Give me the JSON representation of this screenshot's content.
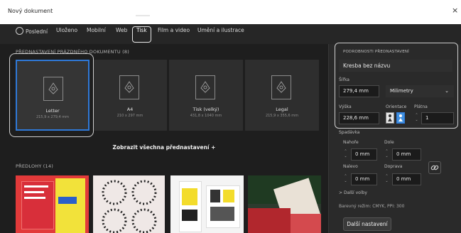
{
  "window": {
    "title": "Nový dokument",
    "close_glyph": "×"
  },
  "tabs": [
    {
      "label": "Poslední",
      "icon": "clock-icon"
    },
    {
      "label": "Uloženo"
    },
    {
      "label": "Mobilní"
    },
    {
      "label": "Web"
    },
    {
      "label": "Tisk",
      "active": true
    },
    {
      "label": "Film a video"
    },
    {
      "label": "Umění a ilustrace"
    }
  ],
  "presets_section": {
    "label": "PŘEDNASTAVENÍ PRÁZDNÉHO DOKUMENTU",
    "count": "(8)"
  },
  "presets": [
    {
      "name": "Letter",
      "size": "215,9 x 279,4 mm",
      "selected": true
    },
    {
      "name": "A4",
      "size": "210 x 297 mm"
    },
    {
      "name": "Tisk (velký)",
      "size": "431,8 x 1040 mm"
    },
    {
      "name": "Legal",
      "size": "215,9 x 355,6 mm"
    }
  ],
  "view_all_label": "Zobrazit všechna přednastavení +",
  "templates_section": {
    "label": "PŘEDLOHY",
    "count": "(14)"
  },
  "details": {
    "header": "PODROBNOSTI PŘEDNASTAVENÍ",
    "name": "Kresba bez názvu",
    "width_label": "Šířka",
    "width_value": "279,4 mm",
    "units_value": "Milimetry",
    "height_label": "Výška",
    "height_value": "228,6 mm",
    "orientation_label": "Orientace",
    "artboards_label": "Plátna",
    "artboards_value": "1",
    "bleed_label": "Spadávka",
    "top_label": "Nahoře",
    "top_value": "0 mm",
    "bottom_label": "Dole",
    "bottom_value": "0 mm",
    "left_label": "Nalevo",
    "left_value": "0 mm",
    "right_label": "Doprava",
    "right_value": "0 mm",
    "more_label": "Další volby",
    "color_mode_text": "Barevný režim: CMYK, PPI: 300",
    "more_settings_button": "Další nastavení"
  },
  "colors": {
    "accent": "#2f79d8",
    "highlight": "#ffffff"
  }
}
